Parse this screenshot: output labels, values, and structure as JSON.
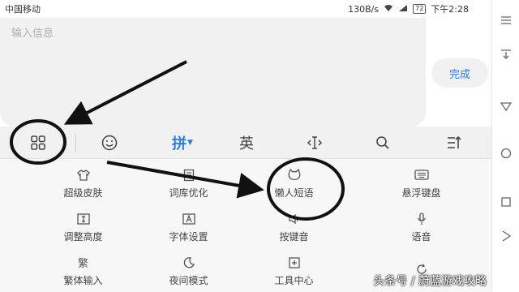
{
  "status_bar": {
    "carrier": "中国移动",
    "speed": "130B/s",
    "battery": "72",
    "time": "下午2:28"
  },
  "input": {
    "placeholder": "输入信息"
  },
  "done_label": "完成",
  "toolbar": {
    "pinyin_label": "拼",
    "english_label": "英"
  },
  "panel": {
    "items": [
      {
        "label": "超级皮肤",
        "icon": "shirt-icon"
      },
      {
        "label": "词库优化",
        "icon": "book-icon"
      },
      {
        "label": "懒人短语",
        "icon": "cat-icon"
      },
      {
        "label": "悬浮键盘",
        "icon": "keyboard-icon"
      },
      {
        "label": "调整高度",
        "icon": "height-icon"
      },
      {
        "label": "字体设置",
        "icon": "font-icon"
      },
      {
        "label": "按键音",
        "icon": "speaker-icon"
      },
      {
        "label": "语音",
        "icon": "microphone-icon"
      },
      {
        "label": "繁体输入",
        "icon": "traditional-icon"
      },
      {
        "label": "夜间模式",
        "icon": "moon-icon"
      },
      {
        "label": "工具中心",
        "icon": "plus-box-icon"
      },
      {
        "label": "",
        "icon": "refresh-icon"
      }
    ],
    "traditional_glyph": "繁"
  },
  "watermark": "头条号 / 蔚蓝游戏攻略",
  "colors": {
    "accent": "#2b7de3",
    "annotation": "#111111"
  }
}
